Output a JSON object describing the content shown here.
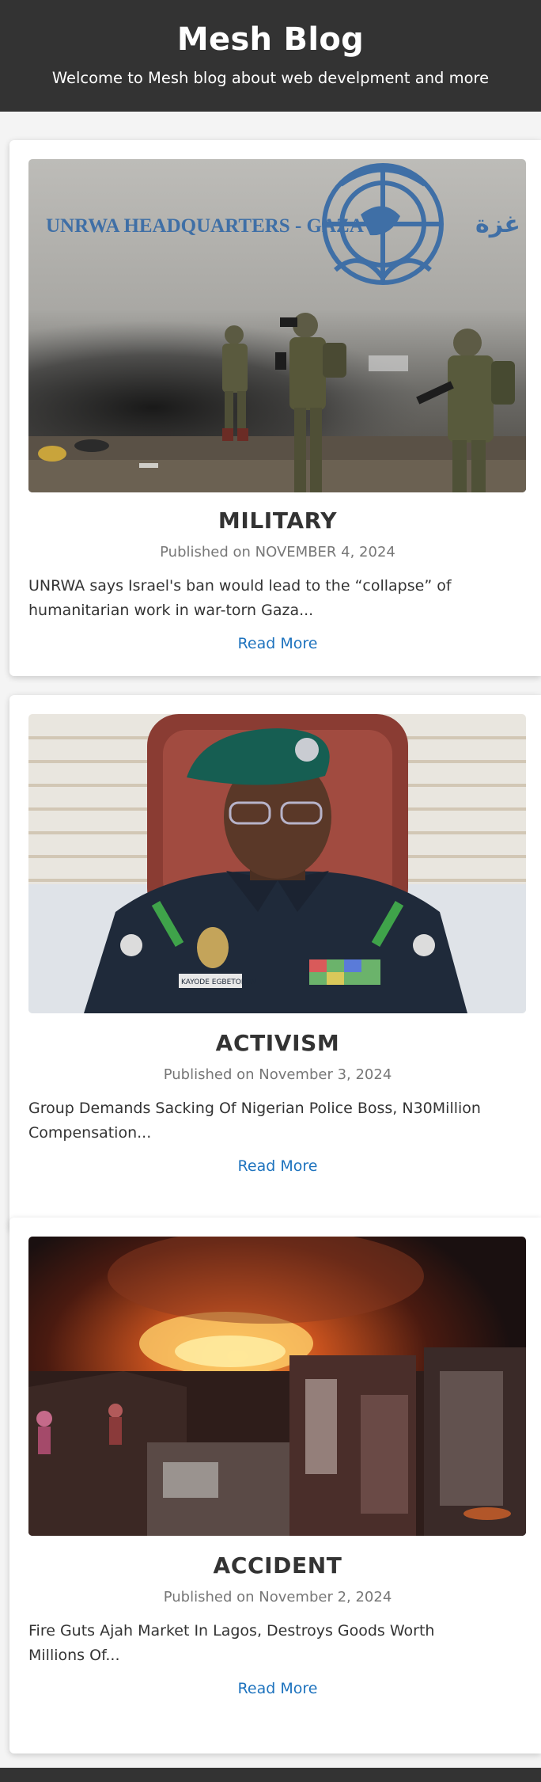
{
  "header": {
    "title": "Mesh Blog",
    "tagline": "Welcome to Mesh blog about web develpment and more"
  },
  "posts": [
    {
      "category": "MILITARY",
      "date": "Published on NOVEMBER 4, 2024",
      "excerpt": "UNRWA says Israel's ban would lead to the “collapse” of humanitarian work in war-torn Gaza...",
      "read_more": "Read More",
      "image": {
        "wall_sign": "UNRWA HEADQUARTERS - GAZA",
        "wall_sign_arabic": "غزة -"
      }
    },
    {
      "category": "ACTIVISM",
      "date": "Published on November 3, 2024",
      "excerpt": "Group Demands Sacking Of Nigerian Police Boss, N30Million Compensation...",
      "read_more": "Read More",
      "image": {
        "name_tag": "KAYODE EGBETOKUN"
      }
    },
    {
      "category": "ACCIDENT",
      "date": "Published on November 2, 2024",
      "excerpt": "Fire Guts Ajah Market In Lagos, Destroys Goods Worth Millions Of...",
      "read_more": "Read More",
      "image": {}
    }
  ],
  "colors": {
    "header_bg": "#333333",
    "link": "#1e73be",
    "date_text": "#777777",
    "page_bg": "#f4f4f4"
  }
}
